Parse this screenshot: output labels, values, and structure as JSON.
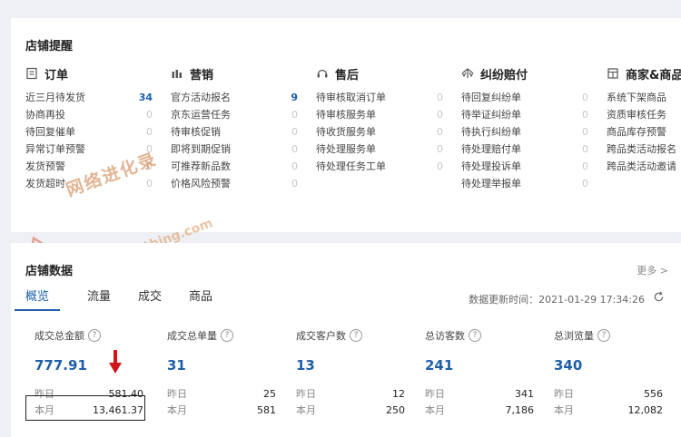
{
  "reminder": {
    "title": "店铺提醒",
    "columns": [
      {
        "name": "订单",
        "icon": "order-icon",
        "items": [
          {
            "label": "近三月待发货",
            "value": "34",
            "hot": true
          },
          {
            "label": "协商再投",
            "value": "0"
          },
          {
            "label": "待回复催单",
            "value": "0"
          },
          {
            "label": "异常订单预警",
            "value": "0"
          },
          {
            "label": "发货预警",
            "value": "0"
          },
          {
            "label": "发货超时",
            "value": "0"
          }
        ]
      },
      {
        "name": "营销",
        "icon": "marketing-icon",
        "items": [
          {
            "label": "官方活动报名",
            "value": "9",
            "hot": true
          },
          {
            "label": "京东运营任务",
            "value": "0"
          },
          {
            "label": "待审核促销",
            "value": "0"
          },
          {
            "label": "即将到期促销",
            "value": "0"
          },
          {
            "label": "可推荐新品数",
            "value": "0"
          },
          {
            "label": "价格风险预警",
            "value": "0"
          }
        ]
      },
      {
        "name": "售后",
        "icon": "headset-icon",
        "items": [
          {
            "label": "待审核取消订单",
            "value": "0"
          },
          {
            "label": "待审核服务单",
            "value": "0"
          },
          {
            "label": "待收货服务单",
            "value": "0"
          },
          {
            "label": "待处理服务单",
            "value": "0"
          },
          {
            "label": "待处理任务工单",
            "value": "0"
          }
        ]
      },
      {
        "name": "纠纷赔付",
        "icon": "dispute-icon",
        "items": [
          {
            "label": "待回复纠纷单",
            "value": "0"
          },
          {
            "label": "待举证纠纷单",
            "value": "0"
          },
          {
            "label": "待执行纠纷单",
            "value": "0"
          },
          {
            "label": "待处理赔付单",
            "value": "0"
          },
          {
            "label": "待处理投诉单",
            "value": "0"
          },
          {
            "label": "待处理举报单",
            "value": "0"
          }
        ]
      },
      {
        "name": "商家&商品",
        "icon": "merchant-icon",
        "items": [
          {
            "label": "系统下架商品",
            "value": ""
          },
          {
            "label": "资质审核任务",
            "value": ""
          },
          {
            "label": "商品库存预警",
            "value": ""
          },
          {
            "label": "跨品类活动报名",
            "value": ""
          },
          {
            "label": "跨品类活动邀请",
            "value": ""
          }
        ]
      }
    ]
  },
  "watermark": {
    "text1": "网络进化录",
    "text2": "www.52thing.com"
  },
  "store_data": {
    "title": "店铺数据",
    "more": "更多 >",
    "tabs": [
      "概览",
      "流量",
      "成交",
      "商品"
    ],
    "update_time": "数据更新时间：2021-01-29 17:34:26",
    "metrics": [
      {
        "label": "成交总金额",
        "value": "777.91",
        "yesterday_label": "昨日",
        "yesterday": "581.40",
        "month_label": "本月",
        "month": "13,461.37"
      },
      {
        "label": "成交总单量",
        "value": "31",
        "yesterday_label": "昨日",
        "yesterday": "25",
        "month_label": "本月",
        "month": "581"
      },
      {
        "label": "成交客户数",
        "value": "13",
        "yesterday_label": "昨日",
        "yesterday": "12",
        "month_label": "本月",
        "month": "250"
      },
      {
        "label": "总访客数",
        "value": "241",
        "yesterday_label": "昨日",
        "yesterday": "341",
        "month_label": "本月",
        "month": "7,186"
      },
      {
        "label": "总浏览量",
        "value": "340",
        "yesterday_label": "昨日",
        "yesterday": "556",
        "month_label": "本月",
        "month": "12,082"
      }
    ]
  },
  "colors": {
    "accent": "#1f5fa8",
    "arrow": "#d0161b"
  }
}
